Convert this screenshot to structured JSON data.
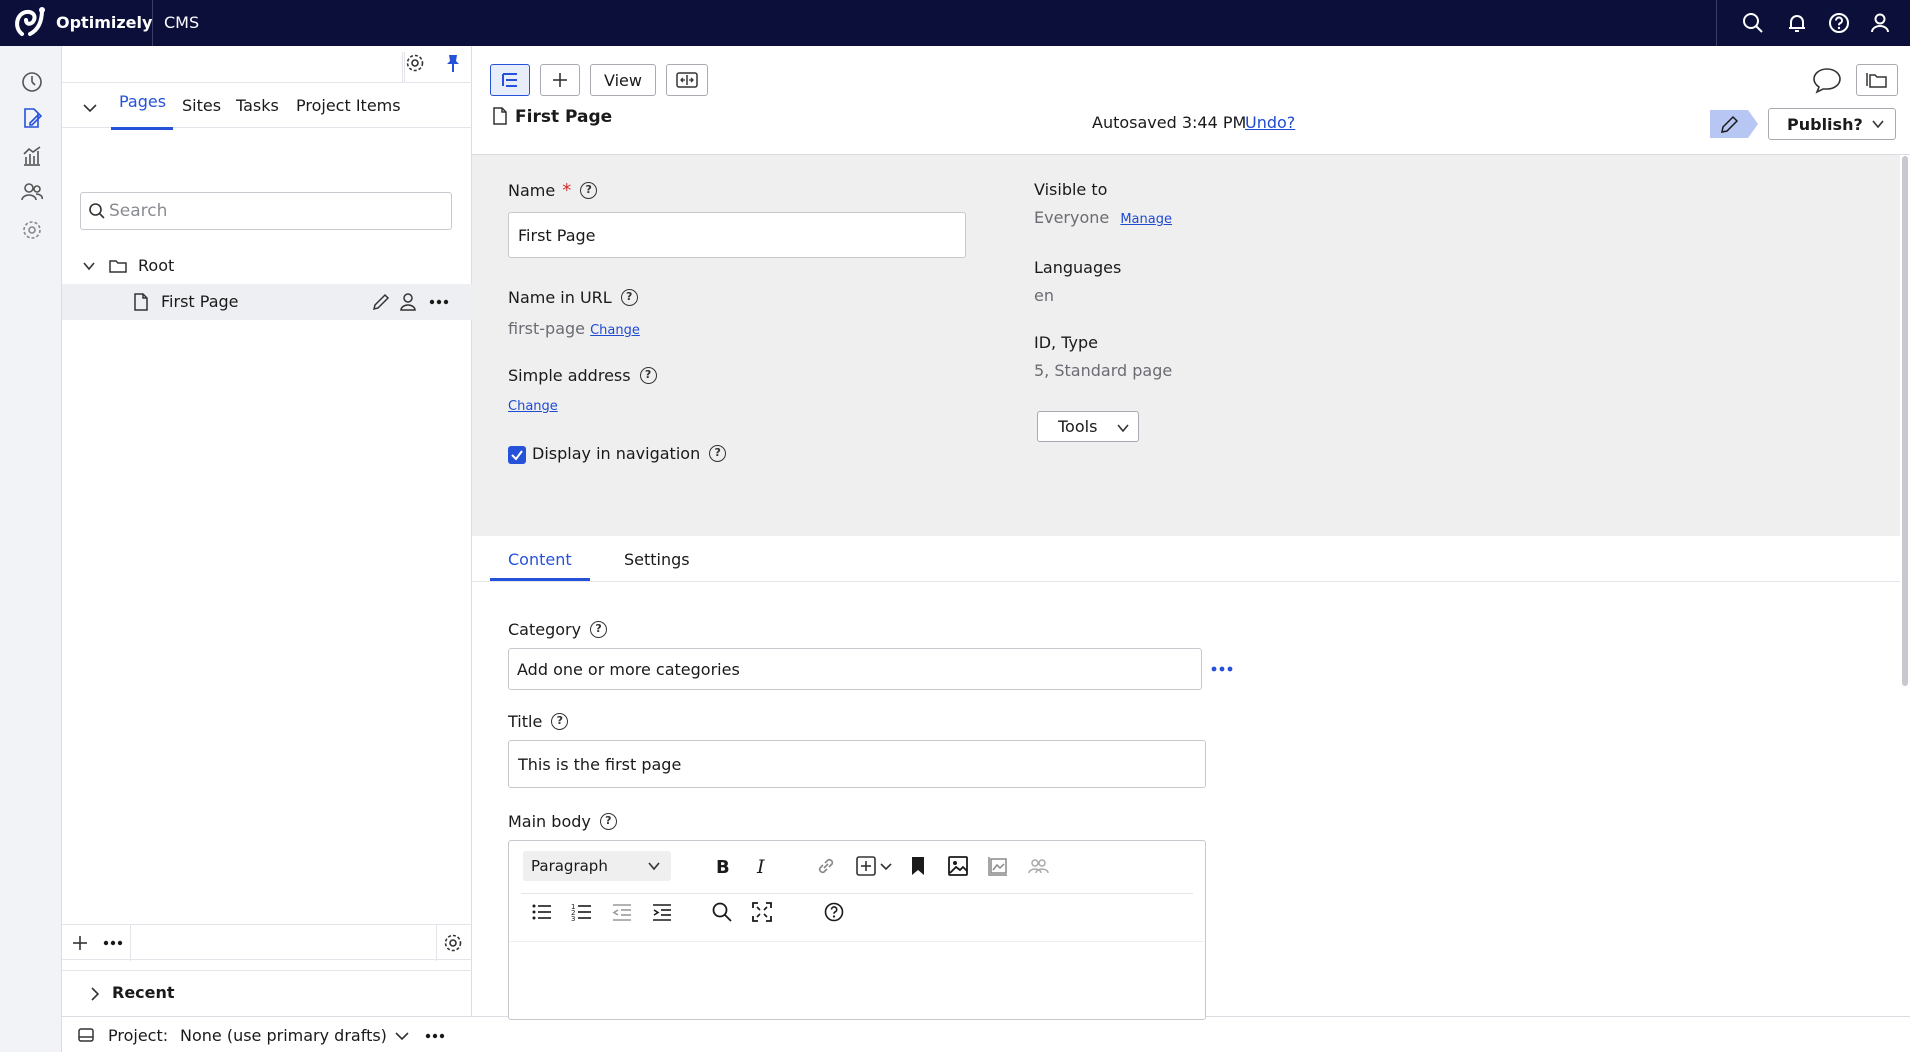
{
  "topbar": {
    "brand": "Optimizely",
    "product": "CMS",
    "icons": [
      "search-icon",
      "bell-icon",
      "help-icon",
      "user-icon"
    ]
  },
  "rail": {
    "icons": [
      "dashboard-icon",
      "edit-icon",
      "analytics-icon",
      "people-icon",
      "settings-icon"
    ]
  },
  "tree": {
    "tabs": [
      "Pages",
      "Sites",
      "Tasks",
      "Project Items"
    ],
    "active_tab": "Pages",
    "search_placeholder": "Search",
    "root_label": "Root",
    "first_page_label": "First Page",
    "recent_label": "Recent"
  },
  "project_bar": {
    "label": "Project:",
    "value": "None (use primary drafts)"
  },
  "toolbar": {
    "view_label": "View",
    "page_title": "First Page",
    "autosaved": "Autosaved 3:44 PM",
    "undo_label": "Undo?",
    "publish_label": "Publish?"
  },
  "form": {
    "name_label": "Name",
    "required_mark": "*",
    "name_value": "First Page",
    "name_in_url_label": "Name in URL",
    "url_segment": "first-page",
    "change_label": "Change",
    "simple_address_label": "Simple address",
    "display_in_nav_label": "Display in navigation",
    "display_in_nav_checked": true,
    "visible_to_label": "Visible to",
    "visible_to_value": "Everyone",
    "manage_label": "Manage",
    "languages_label": "Languages",
    "languages_value": "en",
    "id_type_label": "ID, Type",
    "id_type_value": "5, Standard page",
    "tools_label": "Tools"
  },
  "content_tabs": [
    "Content",
    "Settings"
  ],
  "content": {
    "category_label": "Category",
    "category_placeholder": "Add one or more categories",
    "title_label": "Title",
    "title_value": "This is the first page",
    "main_body_label": "Main body",
    "paragraph_label": "Paragraph"
  },
  "colors": {
    "topbar": "#0b0f3a",
    "accent": "#2552d9",
    "link": "#1f4bd1",
    "panel_bg": "#efefef"
  }
}
